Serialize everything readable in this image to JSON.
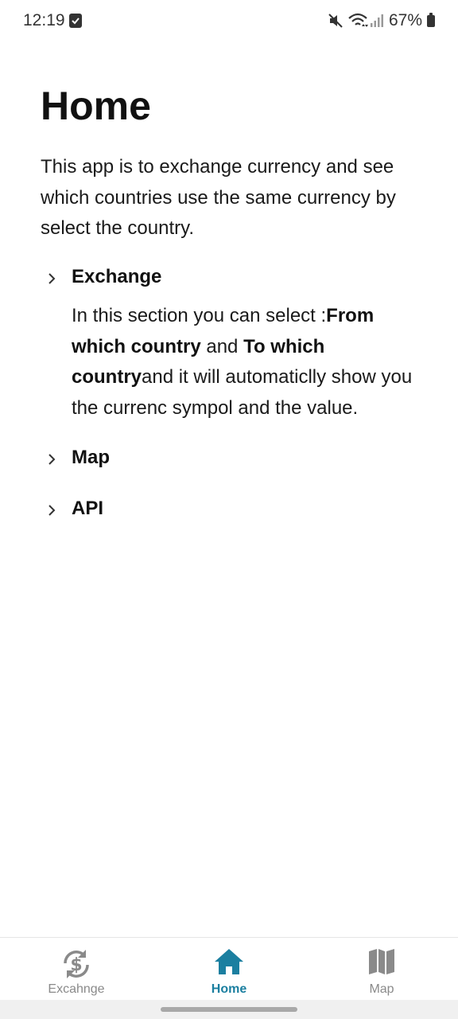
{
  "status_bar": {
    "time": "12:19",
    "battery": "67%"
  },
  "page": {
    "title": "Home",
    "intro": "This app is to exchange currency and see which countries use the same currency by select the country."
  },
  "sections": [
    {
      "title": "Exchange",
      "expanded": true,
      "body": {
        "text1": "In this section you can select :",
        "bold1": "From which country",
        "text2": " and ",
        "bold2": "To which country",
        "text3": "and it will automaticlly show you the currenc sympol and the value."
      }
    },
    {
      "title": "Map",
      "expanded": false
    },
    {
      "title": "API",
      "expanded": false
    }
  ],
  "bottom_nav": {
    "active": "Home",
    "items": [
      {
        "label": "Excahnge",
        "icon": "currency-exchange-icon"
      },
      {
        "label": "Home",
        "icon": "home-icon"
      },
      {
        "label": "Map",
        "icon": "map-icon"
      }
    ]
  },
  "colors": {
    "accent": "#1b7fa0",
    "inactive": "#8a8a8a"
  }
}
